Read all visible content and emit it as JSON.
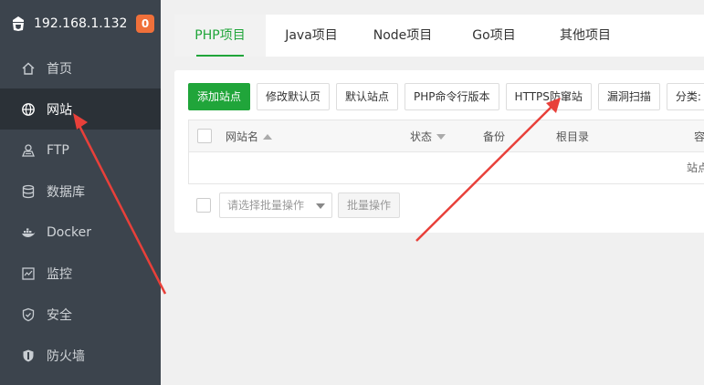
{
  "sidebar": {
    "ip": "192.168.1.132",
    "badge": "0",
    "items": [
      {
        "label": "首页",
        "icon": "home-icon"
      },
      {
        "label": "网站",
        "icon": "globe-icon"
      },
      {
        "label": "FTP",
        "icon": "ftp-icon"
      },
      {
        "label": "数据库",
        "icon": "database-icon"
      },
      {
        "label": "Docker",
        "icon": "docker-icon"
      },
      {
        "label": "监控",
        "icon": "monitor-icon"
      },
      {
        "label": "安全",
        "icon": "shield-icon"
      },
      {
        "label": "防火墙",
        "icon": "firewall-icon"
      }
    ]
  },
  "tabs": [
    "PHP项目",
    "Java项目",
    "Node项目",
    "Go项目",
    "其他项目"
  ],
  "toolbar": {
    "add_site": "添加站点",
    "edit_default_page": "修改默认页",
    "default_site": "默认站点",
    "php_cli_version": "PHP命令行版本",
    "https_anti_hijack": "HTTPS防窜站",
    "vuln_scan": "漏洞扫描",
    "category": "分类:"
  },
  "table": {
    "headers": {
      "site_name": "网站名",
      "status": "状态",
      "backup": "备份",
      "root_dir": "根目录",
      "capacity": "容"
    },
    "empty_text": "站点"
  },
  "batch": {
    "placeholder": "请选择批量操作",
    "button": "批量操作"
  },
  "colors": {
    "accent": "#20a53a",
    "sidebar_bg": "#3c444d",
    "badge": "#f0703a",
    "annotation_arrow": "#e8403a"
  }
}
